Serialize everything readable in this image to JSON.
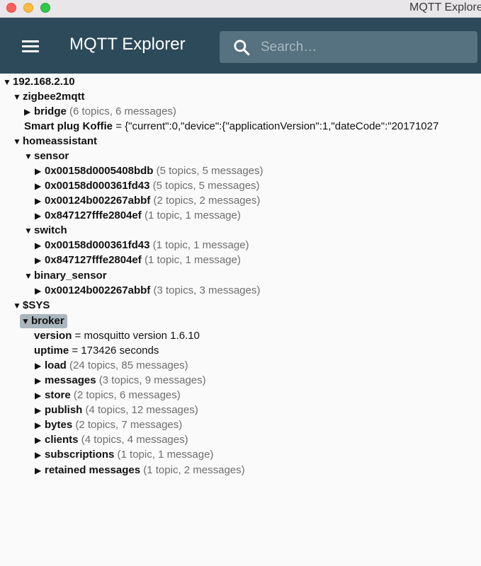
{
  "window": {
    "title": "MQTT Explorer"
  },
  "appbar": {
    "title": "MQTT Explorer",
    "search_placeholder": "Search…"
  },
  "tree": {
    "root": "192.168.2.10",
    "zigbee2mqtt": {
      "label": "zigbee2mqtt",
      "bridge": {
        "label": "bridge",
        "meta": "(6 topics, 6 messages)"
      },
      "smart_plug": {
        "label": "Smart plug Koffie",
        "value": "= {\"current\":0,\"device\":{\"applicationVersion\":1,\"dateCode\":\"20171027"
      }
    },
    "homeassistant": {
      "label": "homeassistant",
      "sensor": {
        "label": "sensor",
        "items": [
          {
            "label": "0x00158d0005408bdb",
            "meta": "(5 topics, 5 messages)"
          },
          {
            "label": "0x00158d000361fd43",
            "meta": "(5 topics, 5 messages)"
          },
          {
            "label": "0x00124b002267abbf",
            "meta": "(2 topics, 2 messages)"
          },
          {
            "label": "0x847127fffe2804ef",
            "meta": "(1 topic, 1 message)"
          }
        ]
      },
      "switch": {
        "label": "switch",
        "items": [
          {
            "label": "0x00158d000361fd43",
            "meta": "(1 topic, 1 message)"
          },
          {
            "label": "0x847127fffe2804ef",
            "meta": "(1 topic, 1 message)"
          }
        ]
      },
      "binary_sensor": {
        "label": "binary_sensor",
        "items": [
          {
            "label": "0x00124b002267abbf",
            "meta": "(3 topics, 3 messages)"
          }
        ]
      }
    },
    "sys": {
      "label": "$SYS",
      "broker": {
        "label": "broker",
        "version": {
          "label": "version",
          "value": "= mosquitto version 1.6.10"
        },
        "uptime": {
          "label": "uptime",
          "value": "= 173426 seconds"
        },
        "items": [
          {
            "label": "load",
            "meta": "(24 topics, 85 messages)"
          },
          {
            "label": "messages",
            "meta": "(3 topics, 9 messages)"
          },
          {
            "label": "store",
            "meta": "(2 topics, 6 messages)"
          },
          {
            "label": "publish",
            "meta": "(4 topics, 12 messages)"
          },
          {
            "label": "bytes",
            "meta": "(2 topics, 7 messages)"
          },
          {
            "label": "clients",
            "meta": "(4 topics, 4 messages)"
          },
          {
            "label": "subscriptions",
            "meta": "(1 topic, 1 message)"
          },
          {
            "label": "retained messages",
            "meta": "(1 topic, 2 messages)"
          }
        ]
      }
    }
  },
  "icons": {
    "expanded": "▼",
    "collapsed": "▶",
    "menu": "hamburger-menu-icon",
    "search": "search-icon"
  },
  "colors": {
    "appbar": "#2c4a59",
    "search_bg": "#56717f",
    "selected": "#a9b6bd",
    "meta_text": "#6e6e6e"
  }
}
